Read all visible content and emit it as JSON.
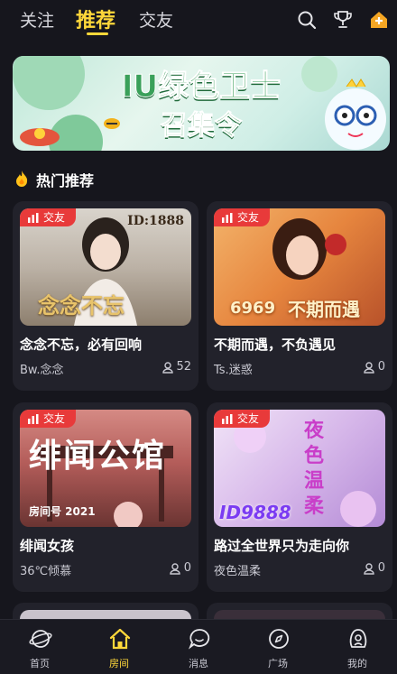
{
  "top_tabs": [
    "关注",
    "推荐",
    "交友"
  ],
  "top_icons": [
    "search-icon",
    "trophy-icon",
    "home-plus-icon"
  ],
  "banner": {
    "line1": "IU绿色卫士",
    "line2": "召集令"
  },
  "section": {
    "title": "热门推荐",
    "icon": "flame-icon"
  },
  "cards": [
    {
      "badge": "交友",
      "cover_text": "念念不忘",
      "cover_id": "ID:1888",
      "title": "念念不忘，必有回响",
      "host": "Bw.念念",
      "count": "52"
    },
    {
      "badge": "交友",
      "cover_text": "不期而遇",
      "cover_id": "6969",
      "title": "不期而遇，不负遇见",
      "host": "Ts.迷惑",
      "count": "0"
    },
    {
      "badge": "交友",
      "cover_text": "绯闻公馆",
      "cover_id": "房间号 2021",
      "title": "绯闻女孩",
      "host": "36℃倾慕",
      "count": "0"
    },
    {
      "badge": "交友",
      "cover_text": "夜色温柔",
      "cover_id": "ID9888",
      "title": "路过全世界只为走向你",
      "host": "夜色温柔",
      "count": "0"
    }
  ],
  "bottom_nav": [
    {
      "label": "首页",
      "icon": "planet-icon"
    },
    {
      "label": "房间",
      "icon": "house-icon"
    },
    {
      "label": "消息",
      "icon": "chat-icon"
    },
    {
      "label": "广场",
      "icon": "compass-icon"
    },
    {
      "label": "我的",
      "icon": "profile-icon"
    }
  ],
  "colors": {
    "accent": "#ffd83a",
    "badge": "#e83a3a",
    "background": "#16161d",
    "card": "#22222b"
  }
}
